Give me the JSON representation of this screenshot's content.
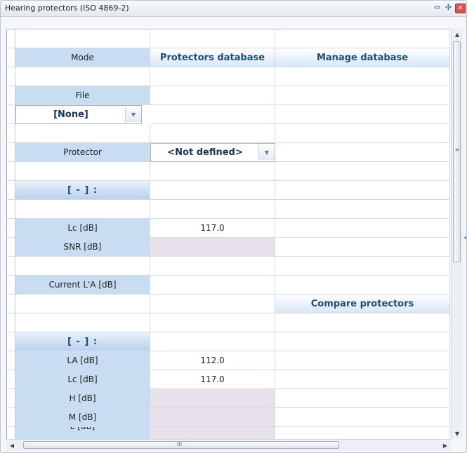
{
  "window": {
    "title": "Hearing protectors (ISO 4869-2)",
    "buttons": {
      "restore": "restore-icon",
      "maximize": "maximize-icon",
      "close": "close-icon"
    }
  },
  "labels": {
    "mode": "Mode",
    "file": "File",
    "protector": "Protector",
    "section1": "[ - ]  :",
    "lc": "Lc [dB]",
    "snr": "SNR [dB]",
    "current_la": "Current L'A [dB]",
    "section2": "[ - ]  :",
    "la2": "LA [dB]",
    "lc2": "Lc [dB]",
    "h": "H [dB]",
    "m": "M [dB]",
    "l_partial": "L [dB]"
  },
  "headers": {
    "protectors_database": "Protectors database",
    "manage_database": "Manage database",
    "compare_protectors": "Compare protectors"
  },
  "dropdowns": {
    "file_value": "[None]",
    "protector_value": "<Not defined>"
  },
  "values": {
    "lc": "117.0",
    "la2": "112.0",
    "lc2": "117.0"
  },
  "scrollbar": {
    "up": "▲",
    "down": "▼",
    "left": "◀",
    "right": "▶",
    "vgrip": "≡",
    "hgrip": "III"
  },
  "colors": {
    "label_bg": "#c8ddf2",
    "header_text": "#1d4f7a",
    "disabled_bg": "#e6e1ea"
  }
}
